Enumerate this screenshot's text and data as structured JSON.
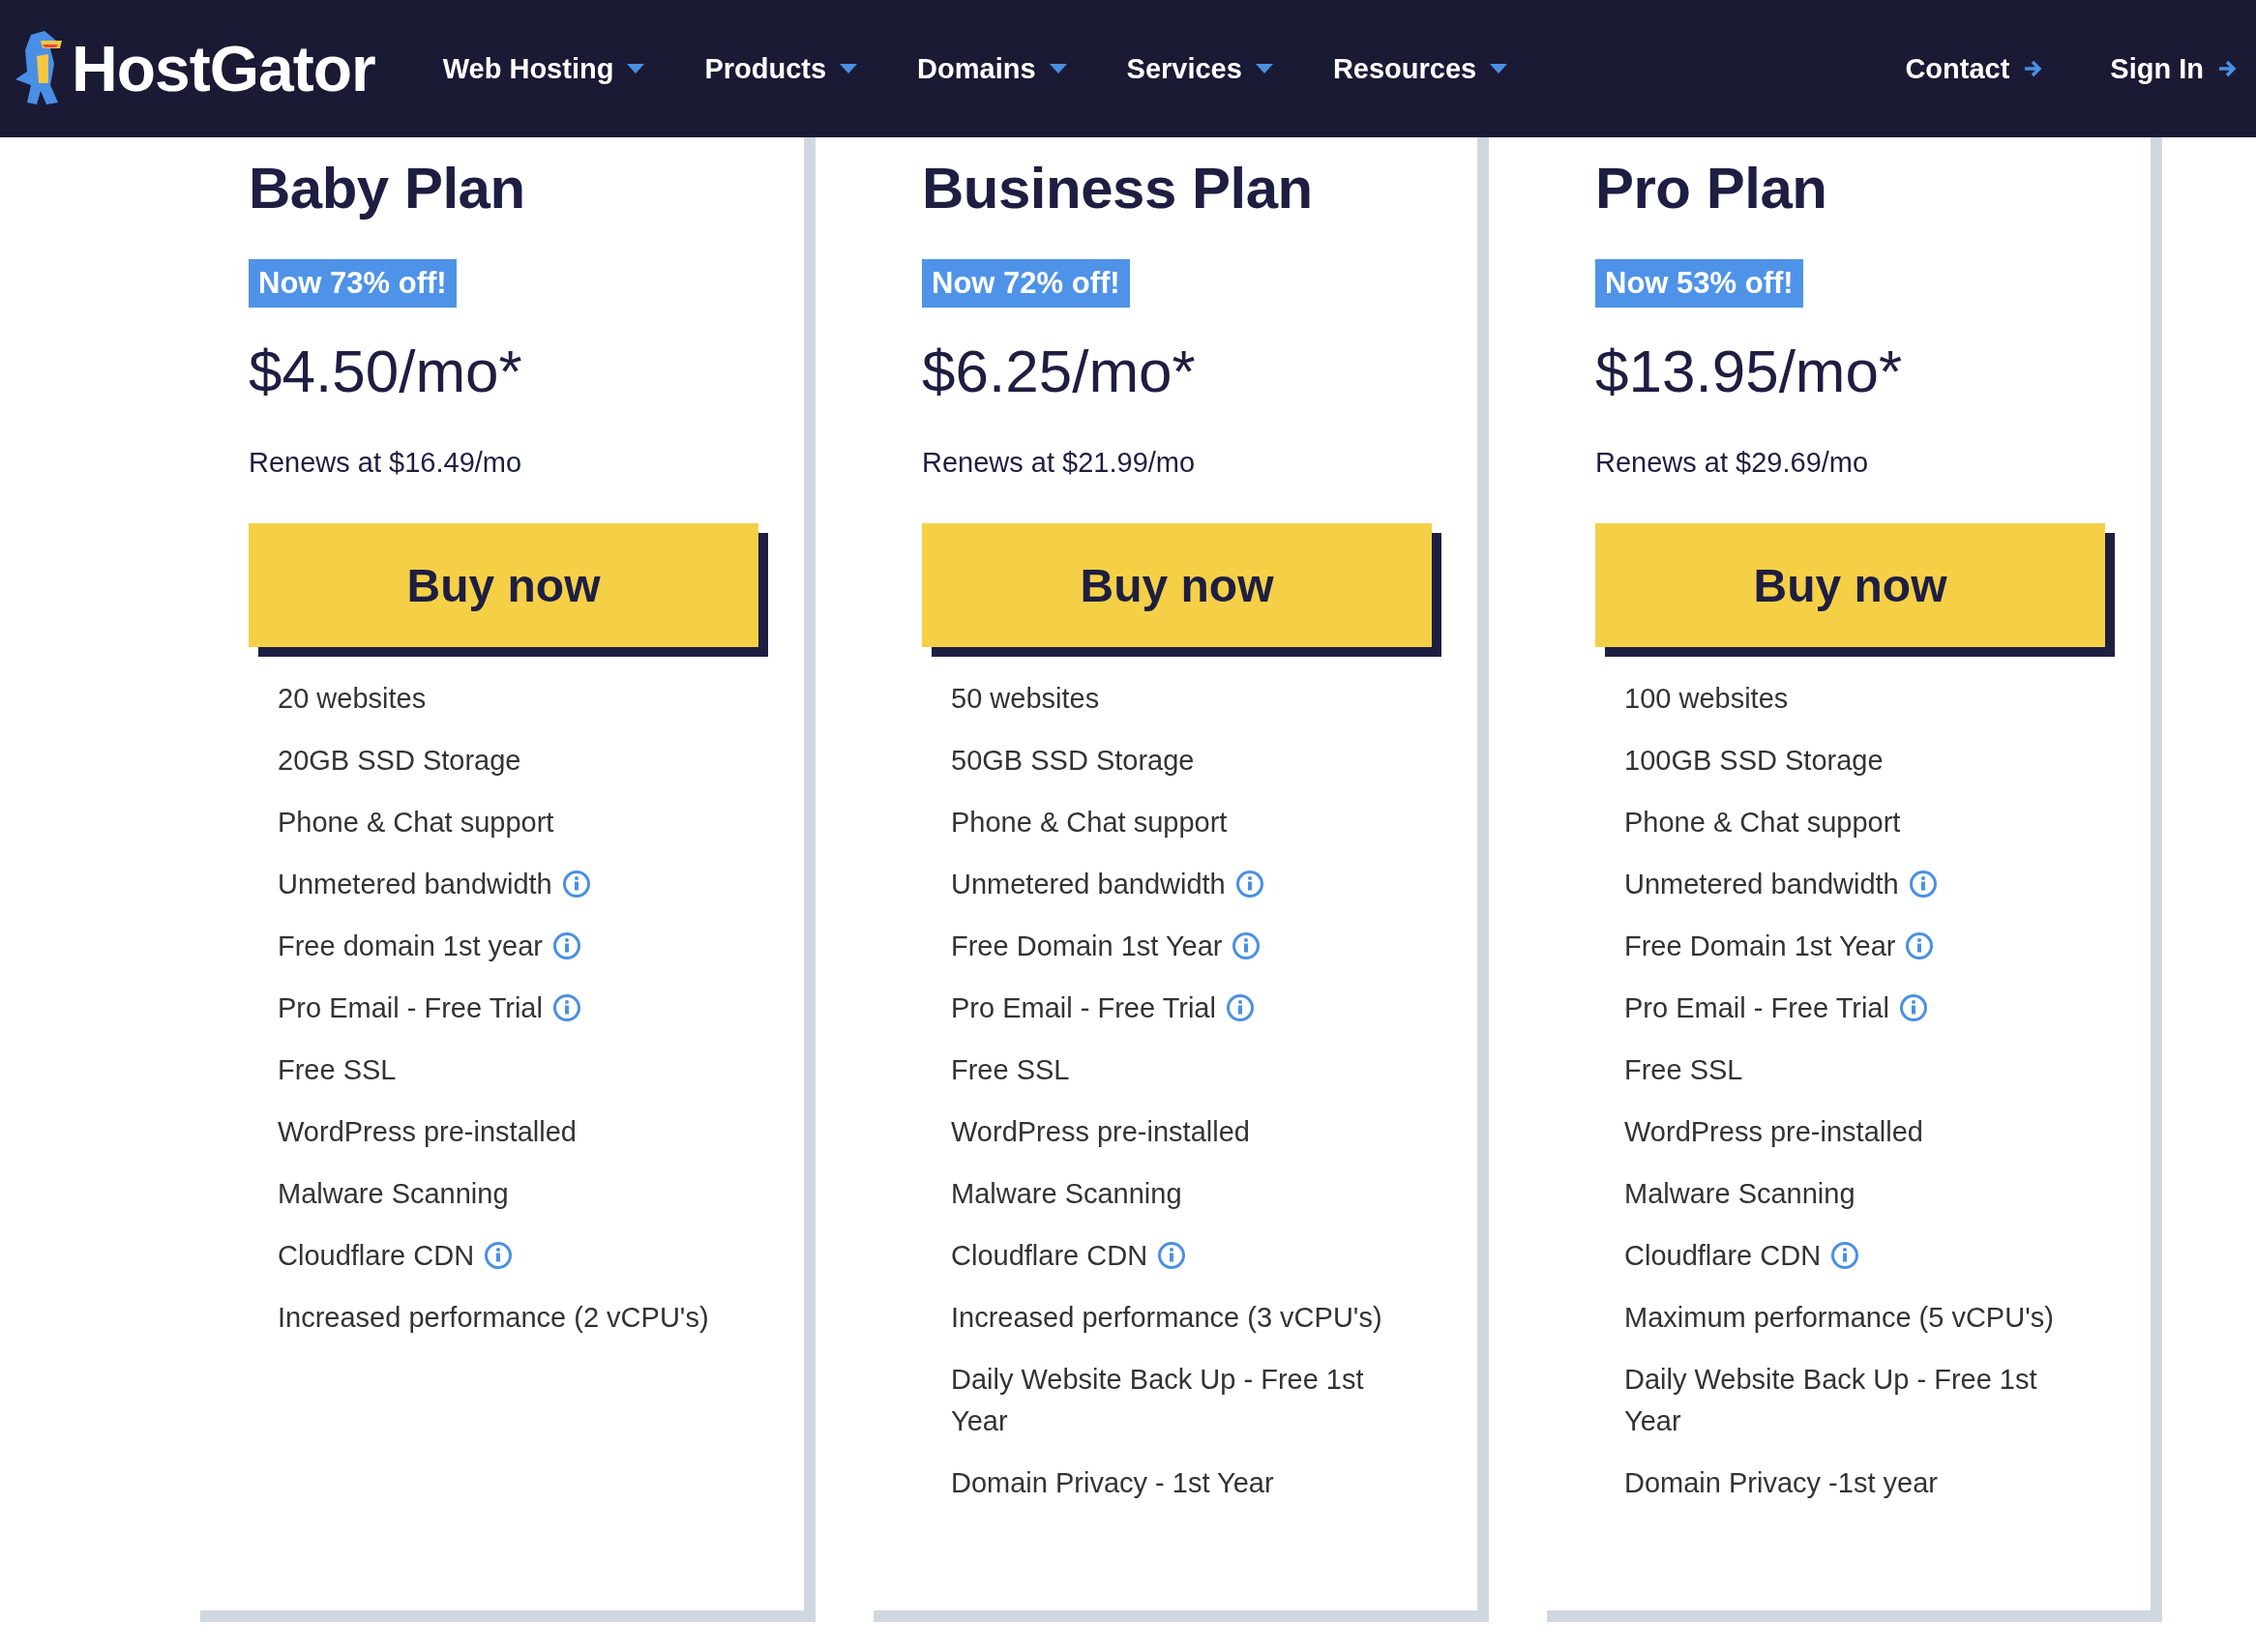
{
  "header": {
    "logo": "HostGator",
    "nav": [
      {
        "label": "Web Hosting",
        "kind": "dropdown"
      },
      {
        "label": "Products",
        "kind": "dropdown"
      },
      {
        "label": "Domains",
        "kind": "dropdown"
      },
      {
        "label": "Services",
        "kind": "dropdown"
      },
      {
        "label": "Resources",
        "kind": "dropdown"
      }
    ],
    "actions": [
      {
        "label": "Contact",
        "kind": "link"
      },
      {
        "label": "Sign In",
        "kind": "link"
      }
    ]
  },
  "plans": [
    {
      "name": "Baby Plan",
      "badge": "Now 73% off!",
      "price": "$4.50/mo*",
      "renews": "Renews at $16.49/mo",
      "button": "Buy now",
      "features": [
        {
          "text": "20 websites",
          "info": false
        },
        {
          "text": "20GB SSD Storage",
          "info": false
        },
        {
          "text": "Phone & Chat support",
          "info": false
        },
        {
          "text": "Unmetered bandwidth",
          "info": true
        },
        {
          "text": "Free domain 1st year",
          "info": true
        },
        {
          "text": "Pro Email - Free Trial",
          "info": true
        },
        {
          "text": "Free SSL",
          "info": false
        },
        {
          "text": "WordPress pre-installed",
          "info": false
        },
        {
          "text": "Malware Scanning",
          "info": false
        },
        {
          "text": "Cloudflare CDN",
          "info": true
        },
        {
          "text": "Increased performance (2 vCPU's)",
          "info": false
        }
      ]
    },
    {
      "name": "Business Plan",
      "badge": "Now 72% off!",
      "price": "$6.25/mo*",
      "renews": "Renews at $21.99/mo",
      "button": "Buy now",
      "features": [
        {
          "text": "50 websites",
          "info": false
        },
        {
          "text": "50GB SSD Storage",
          "info": false
        },
        {
          "text": "Phone & Chat support",
          "info": false
        },
        {
          "text": "Unmetered bandwidth",
          "info": true
        },
        {
          "text": "Free Domain 1st Year",
          "info": true
        },
        {
          "text": "Pro Email - Free Trial",
          "info": true
        },
        {
          "text": "Free SSL",
          "info": false
        },
        {
          "text": "WordPress pre-installed",
          "info": false
        },
        {
          "text": "Malware Scanning",
          "info": false
        },
        {
          "text": "Cloudflare CDN",
          "info": true
        },
        {
          "text": "Increased performance (3 vCPU's)",
          "info": false
        },
        {
          "text": "Daily Website Back Up - Free 1st Year",
          "info": false
        },
        {
          "text": "Domain Privacy - 1st Year",
          "info": false
        }
      ]
    },
    {
      "name": "Pro Plan",
      "badge": "Now 53% off!",
      "price": "$13.95/mo*",
      "renews": "Renews at $29.69/mo",
      "button": "Buy now",
      "features": [
        {
          "text": "100 websites",
          "info": false
        },
        {
          "text": "100GB SSD Storage",
          "info": false
        },
        {
          "text": "Phone & Chat support",
          "info": false
        },
        {
          "text": "Unmetered bandwidth",
          "info": true
        },
        {
          "text": "Free Domain 1st Year",
          "info": true
        },
        {
          "text": "Pro Email - Free Trial",
          "info": true
        },
        {
          "text": "Free SSL",
          "info": false
        },
        {
          "text": "WordPress pre-installed",
          "info": false
        },
        {
          "text": "Malware Scanning",
          "info": false
        },
        {
          "text": "Cloudflare CDN",
          "info": true
        },
        {
          "text": "Maximum performance (5 vCPU's)",
          "info": false
        },
        {
          "text": "Daily Website Back Up - Free 1st Year",
          "info": false
        },
        {
          "text": "Domain Privacy -1st year",
          "info": false
        }
      ]
    }
  ]
}
